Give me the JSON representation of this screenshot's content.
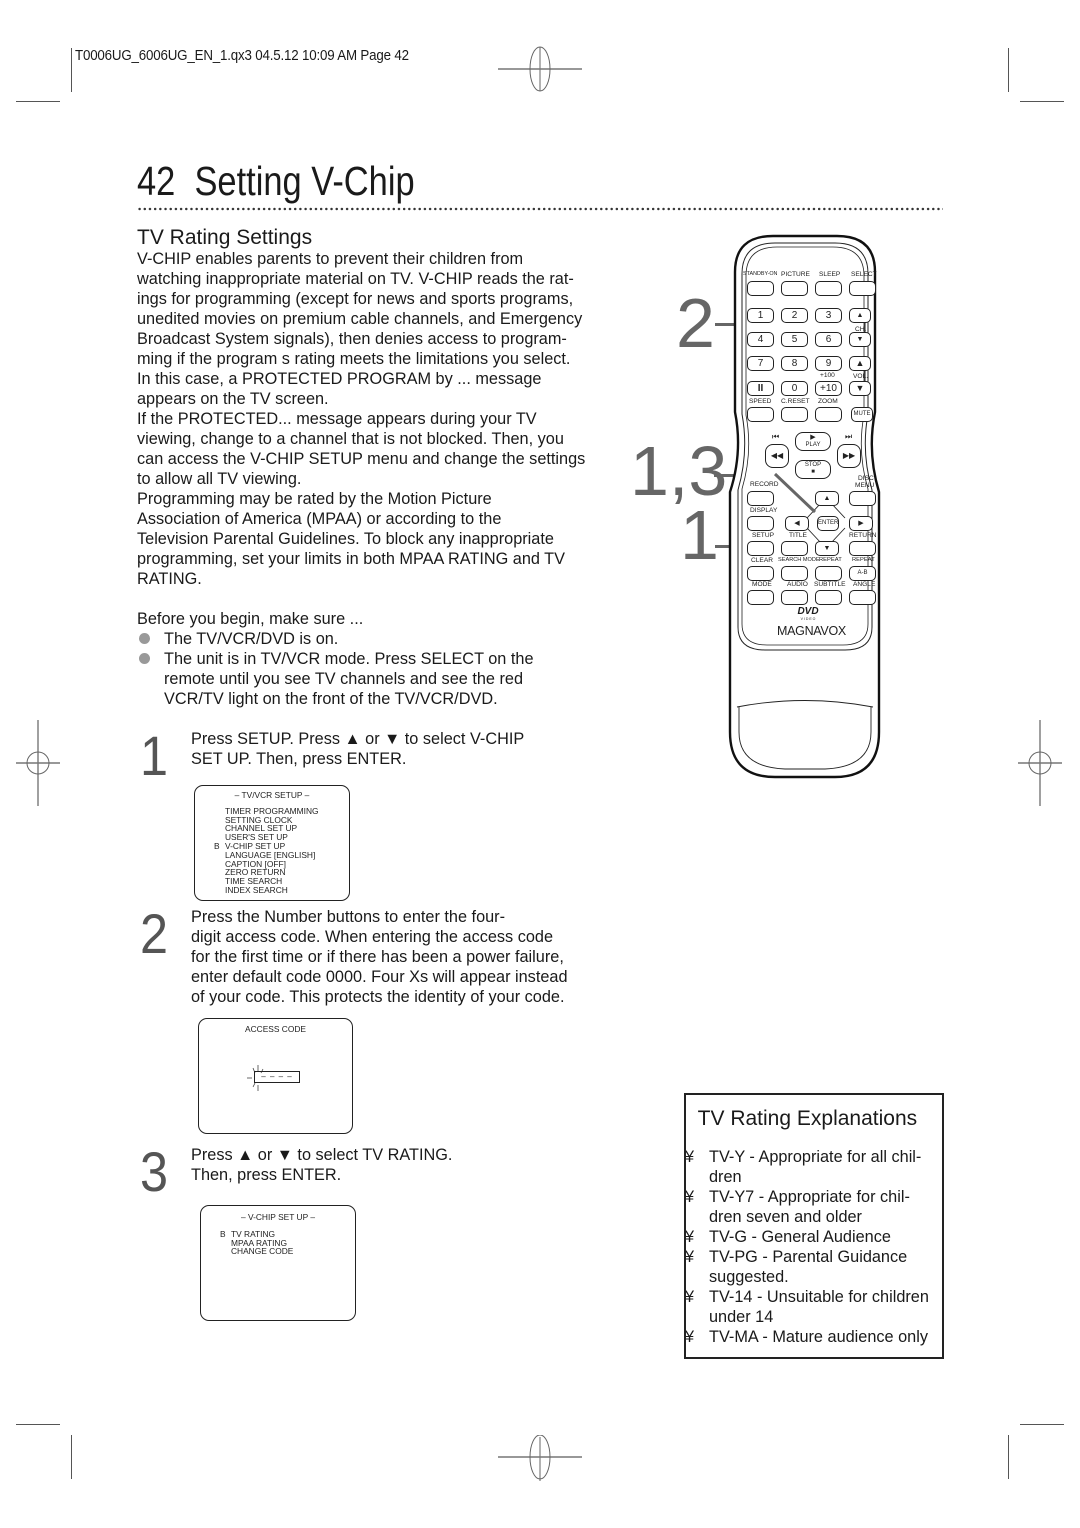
{
  "slug": "T0006UG_6006UG_EN_1.qx3  04.5.12  10:09 AM  Page 42",
  "page": {
    "number": "42",
    "title": "Setting V-Chip"
  },
  "section": {
    "heading": "TV Rating Settings",
    "intro_lines": [
      "V-CHIP enables parents to prevent their children from",
      "watching inappropriate material on TV. V-CHIP reads the rat-",
      "ings for programming (except for news and sports programs,",
      "unedited movies on premium cable channels, and Emergency",
      "Broadcast System signals), then denies access to program-",
      "ming if the program s rating meets the limitations you select.",
      "In this case, a  PROTECTED PROGRAM by ...  message",
      "appears on the TV screen.",
      "If the  PROTECTED...  message appears during your TV",
      "viewing, change to a channel that is not blocked. Then, you",
      "can access the V-CHIP SETUP menu and change the settings",
      "to allow all TV viewing.",
      "Programming may be rated by the Motion Picture",
      "Association of America (MPAA) or according to the",
      "Television Parental Guidelines. To block any inappropriate",
      "programming, set your limits in both MPAA RATING and TV",
      "RATING."
    ],
    "before_heading": "Before you begin, make sure ...",
    "before_items": [
      [
        "The TV/VCR/DVD is on."
      ],
      [
        "The unit is in TV/VCR mode. Press SELECT on the",
        "remote until you see TV channels and see the red",
        "VCR/TV light on the front of the TV/VCR/DVD."
      ]
    ]
  },
  "steps": [
    {
      "number": "1",
      "lines": [
        "Press SETUP. Press ▲ or  ▼ to select V-CHIP",
        "SET UP. Then, press ENTER."
      ],
      "screen": {
        "title": "– TV/VCR SETUP –",
        "cursor": "B",
        "selected_index": 4,
        "items": [
          "TIMER PROGRAMMING",
          "SETTING CLOCK",
          "CHANNEL SET UP",
          "USER'S SET UP",
          "V-CHIP SET UP",
          "LANGUAGE  [ENGLISH]",
          "CAPTION  [OFF]",
          "ZERO RETURN",
          "TIME SEARCH",
          "INDEX SEARCH"
        ]
      }
    },
    {
      "number": "2",
      "lines": [
        "Press the Number buttons to enter the four-",
        "digit access code. When entering the access code",
        "for the first time or if there has been a power failure,",
        "enter default code 0000. Four Xs will appear instead",
        "of your code. This protects the identity of your code."
      ],
      "screen": {
        "title": "ACCESS CODE",
        "field": "– – – –"
      }
    },
    {
      "number": "3",
      "lines": [
        "Press ▲ or  ▼ to select TV RATING.",
        "Then, press ENTER."
      ],
      "screen": {
        "title": "– V-CHIP SET UP –",
        "cursor": "B",
        "selected_index": 0,
        "items": [
          "TV RATING",
          "MPAA RATING",
          "CHANGE CODE"
        ]
      }
    }
  ],
  "callouts": [
    "2",
    "1,3",
    "1"
  ],
  "remote": {
    "brand": "MAGNAVOX",
    "dvd_logo": "DVD",
    "dvd_sub": "V I D E O",
    "top_labels": [
      "STANDBY-ON",
      "PICTURE",
      "SLEEP",
      "SELECT"
    ],
    "number_keys": [
      "1",
      "2",
      "3",
      "4",
      "5",
      "6",
      "7",
      "8",
      "9",
      "II",
      "0",
      "+10"
    ],
    "plus100": "+100",
    "ch_label": "CH.",
    "vol_label": "VOL.",
    "row_speed": [
      "SPEED",
      "C.RESET",
      "ZOOM"
    ],
    "mute": "MUTE",
    "play": "PLAY",
    "stop": "STOP",
    "record": "RECORD",
    "disc_menu": [
      "DISC",
      "MENU"
    ],
    "display": "DISPLAY",
    "enter": "ENTER",
    "row_setup": [
      "SETUP",
      "TITLE",
      "RETURN"
    ],
    "row_clear": [
      "CLEAR",
      "SEARCH MODE",
      "REPEAT",
      "REPEAT"
    ],
    "ab": "A-B",
    "row_mode": [
      "MODE",
      "AUDIO",
      "SUBTITLE",
      "ANGLE"
    ]
  },
  "explanations": {
    "heading": "TV Rating Explanations",
    "bullet_mark": "¥",
    "items": [
      [
        "TV-Y - Appropriate for all chil-",
        "dren"
      ],
      [
        "TV-Y7 - Appropriate for chil-",
        "dren seven and older"
      ],
      [
        "TV-G - General Audience"
      ],
      [
        "TV-PG - Parental Guidance",
        "suggested."
      ],
      [
        "TV-14 - Unsuitable for children",
        "under 14"
      ],
      [
        "TV-MA - Mature audience only"
      ]
    ]
  }
}
